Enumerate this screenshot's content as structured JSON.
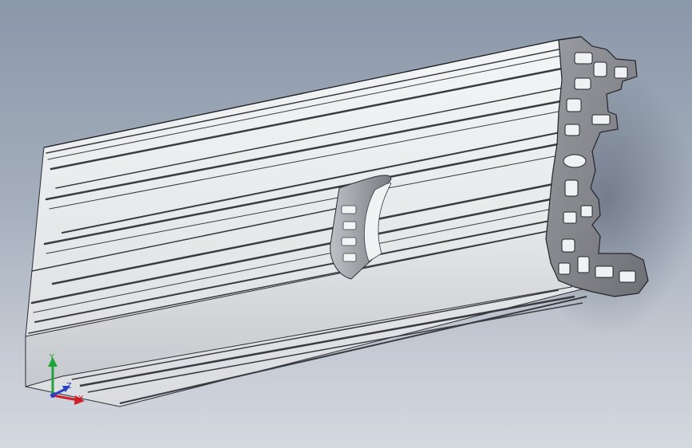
{
  "viewport": {
    "background_top": "#8b98a9",
    "background_bottom": "#d4d8df"
  },
  "model": {
    "part": "aluminum-t-slot-extrusion",
    "section_view": true
  },
  "triad": {
    "x_label": "X",
    "y_label": "Y",
    "z_label": "Z",
    "x_color": "#d0202a",
    "y_color": "#1fa33a",
    "z_color": "#2a3fc8"
  }
}
